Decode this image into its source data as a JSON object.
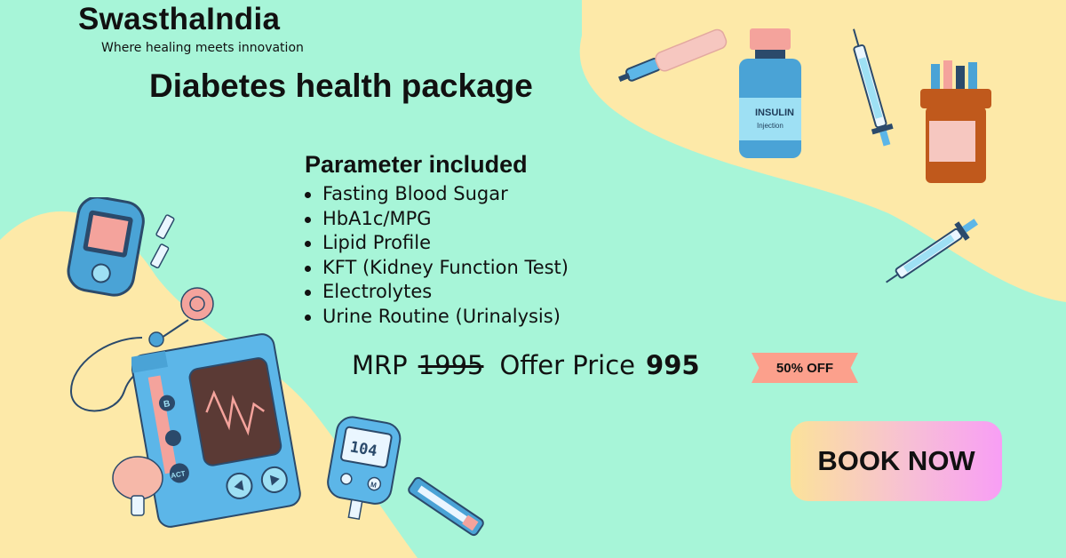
{
  "brand": {
    "name": "SwasthaIndia",
    "tagline": "Where healing meets innovation"
  },
  "package": {
    "title": "Diabetes health package"
  },
  "parameters": {
    "heading": "Parameter included",
    "items": [
      "Fasting Blood Sugar",
      "HbA1c/MPG",
      "Lipid Profile",
      "KFT (Kidney Function Test)",
      "Electrolytes",
      "Urine Routine (Urinalysis)"
    ]
  },
  "pricing": {
    "mrp_label": "MRP",
    "mrp_value": "1995",
    "offer_label": "Offer Price",
    "offer_value": "995",
    "discount_badge": "50% OFF"
  },
  "cta": {
    "label": "BOOK NOW"
  },
  "illustrations": {
    "insulin_label": "INSULIN",
    "injection_label": "Injection",
    "meter_reading": "104",
    "pump_btn_b": "B",
    "pump_btn_act": "ACT",
    "meter_btn_m": "M"
  },
  "colors": {
    "background": "#a7f5d8",
    "blob": "#fde9a8",
    "badge": "#fca08c",
    "device_blue": "#5cb6e8",
    "bottle_orange": "#c0591c"
  }
}
